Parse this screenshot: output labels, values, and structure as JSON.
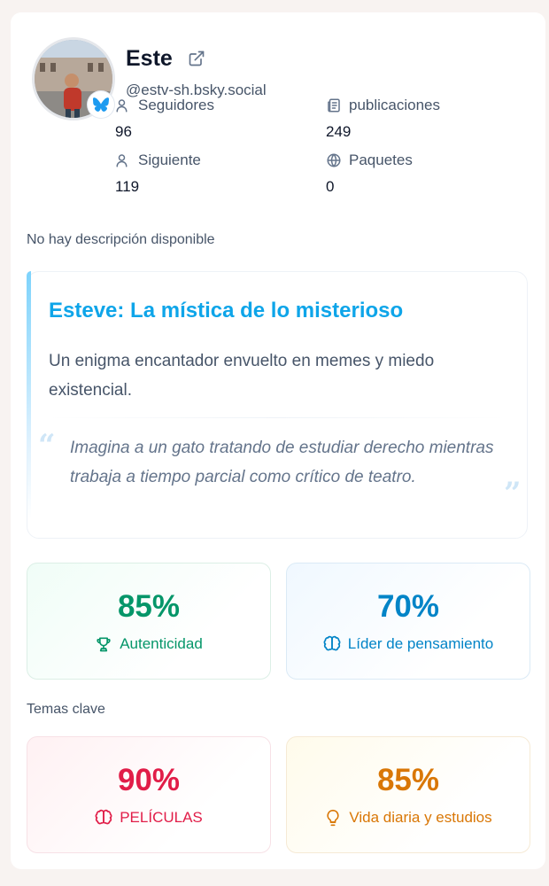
{
  "profile": {
    "name": "Este",
    "handle": "@estv-sh.bsky.social",
    "description": "No hay descripción disponible"
  },
  "stats": {
    "followers_label": "Seguidores",
    "followers_value": "96",
    "posts_label": "publicaciones",
    "posts_value": "249",
    "following_label": "Siguiente",
    "following_value": "119",
    "packs_label": "Paquetes",
    "packs_value": "0"
  },
  "persona": {
    "title": "Esteve: La mística de lo misterioso",
    "subtitle": "Un enigma encantador envuelto en memes y miedo existencial.",
    "quote": "Imagina a un gato tratando de estudiar derecho mientras trabaja a tiempo parcial como crítico de teatro."
  },
  "metrics": [
    {
      "value": "85%",
      "label": "Autenticidad",
      "icon": "trophy-icon",
      "color": "#059669"
    },
    {
      "value": "70%",
      "label": "Líder de pensamiento",
      "icon": "brain-icon",
      "color": "#0284c7"
    }
  ],
  "topics": {
    "heading": "Temas clave",
    "items": [
      {
        "value": "90%",
        "label": "PELÍCULAS",
        "icon": "brain-icon",
        "color": "#e11d48"
      },
      {
        "value": "85%",
        "label": "Vida diaria y estudios",
        "icon": "lightbulb-icon",
        "color": "#d97706"
      }
    ]
  },
  "colors": {
    "accent": "#0ea5e9",
    "badge": "#1d9bf0"
  }
}
